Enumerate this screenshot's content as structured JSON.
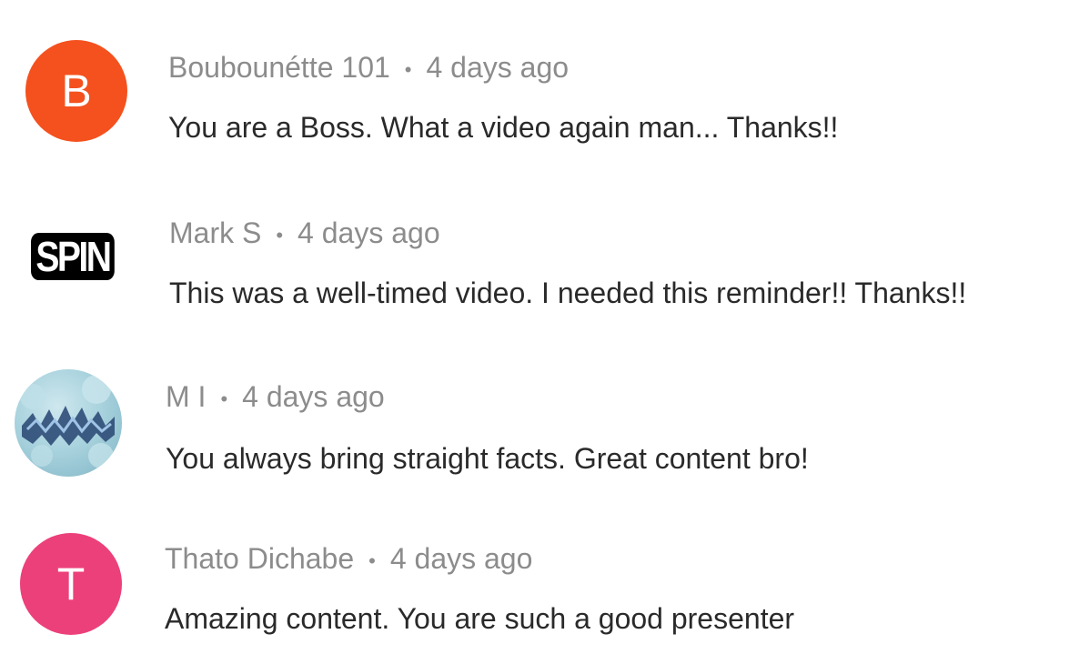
{
  "comments": [
    {
      "author": "Boubounétte 101",
      "time": "4 days ago",
      "text": "You are a Boss. What a video again man... Thanks!!",
      "avatar_letter": "B",
      "avatar_color": "#f4511e"
    },
    {
      "author": "Mark S",
      "time": "4 days ago",
      "text": "This was a well-timed video. I needed this reminder!! Thanks!!",
      "avatar_text": "SPIN",
      "avatar_color": "#000000"
    },
    {
      "author": "M I",
      "time": "4 days ago",
      "text": "You always bring straight facts. Great content bro!",
      "avatar_color": "#a9d3de"
    },
    {
      "author": "Thato Dichabe",
      "time": "4 days ago",
      "text": "Amazing content. You are such a good presenter",
      "avatar_letter": "T",
      "avatar_color": "#ec407a"
    }
  ],
  "separator": "•"
}
